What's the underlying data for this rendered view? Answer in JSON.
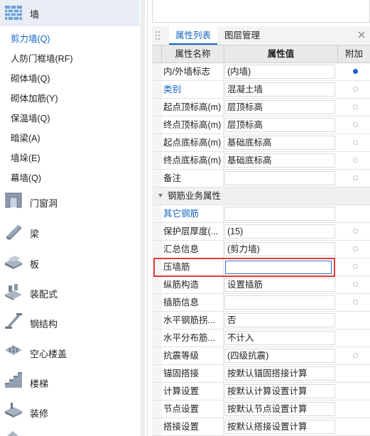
{
  "nav": {
    "sections": [
      {
        "label": "墙",
        "icon": "wall-icon",
        "active": true
      },
      {
        "label": "门窗洞",
        "icon": "door-window-icon"
      },
      {
        "label": "梁",
        "icon": "beam-icon"
      },
      {
        "label": "板",
        "icon": "slab-icon"
      },
      {
        "label": "装配式",
        "icon": "prefab-icon"
      },
      {
        "label": "钢结构",
        "icon": "steel-structure-icon"
      },
      {
        "label": "空心楼盖",
        "icon": "hollow-floor-icon"
      },
      {
        "label": "楼梯",
        "icon": "stairs-icon"
      },
      {
        "label": "装修",
        "icon": "decoration-icon"
      }
    ],
    "wall_items": [
      {
        "label": "剪力墙(Q)",
        "selected": true
      },
      {
        "label": "人防门框墙(RF)"
      },
      {
        "label": "砌体墙(Q)"
      },
      {
        "label": "砌体加筋(Y)"
      },
      {
        "label": "保温墙(Q)"
      },
      {
        "label": "暗梁(A)"
      },
      {
        "label": "墙垛(E)"
      },
      {
        "label": "幕墙(Q)"
      }
    ]
  },
  "tabs": [
    "属性列表",
    "图层管理"
  ],
  "grid": {
    "headers": {
      "name": "属性名称",
      "value": "属性值",
      "extra": "附加"
    },
    "rows": [
      {
        "name": "内/外墙标志",
        "value": "(内墙)",
        "radio": "on"
      },
      {
        "name": "类别",
        "value": "混凝土墙",
        "radio": "off",
        "link": true
      },
      {
        "name": "起点顶标高(m)",
        "value": "层顶标高",
        "radio": "off"
      },
      {
        "name": "终点顶标高(m)",
        "value": "层顶标高",
        "radio": "off"
      },
      {
        "name": "起点底标高(m)",
        "value": "基础底标高",
        "radio": "off"
      },
      {
        "name": "终点底标高(m)",
        "value": "基础底标高",
        "radio": "off"
      },
      {
        "name": "备注",
        "value": "",
        "radio": "off"
      }
    ],
    "group_label": "钢筋业务属性",
    "rebar_rows": [
      {
        "name": "其它钢筋",
        "value": "",
        "radio": "none",
        "link": true
      },
      {
        "name": "保护层厚度(...",
        "value": "(15)",
        "radio": "off"
      },
      {
        "name": "汇总信息",
        "value": "(剪力墙)",
        "radio": "off"
      },
      {
        "name": "压墙筋",
        "value": "",
        "radio": "off",
        "editing": true
      },
      {
        "name": "纵筋构造",
        "value": "设置插筋",
        "radio": "off"
      },
      {
        "name": "插筋信息",
        "value": "",
        "radio": "off"
      },
      {
        "name": "水平钢筋拐...",
        "value": "否",
        "radio": "none"
      },
      {
        "name": "水平分布筋...",
        "value": "不计入",
        "radio": "none"
      },
      {
        "name": "抗震等级",
        "value": "(四级抗震)",
        "radio": "off"
      },
      {
        "name": "锚固搭接",
        "value": "按默认锚固搭接计算",
        "radio": "none"
      },
      {
        "name": "计算设置",
        "value": "按默认计算设置计算",
        "radio": "none"
      },
      {
        "name": "节点设置",
        "value": "按默认节点设置计算",
        "radio": "none"
      },
      {
        "name": "搭接设置",
        "value": "按默认搭接设置计算",
        "radio": "none"
      }
    ]
  },
  "colors": {
    "accent": "#1565c0",
    "highlight": "#e53935",
    "radio_on": "#1e62d0"
  }
}
